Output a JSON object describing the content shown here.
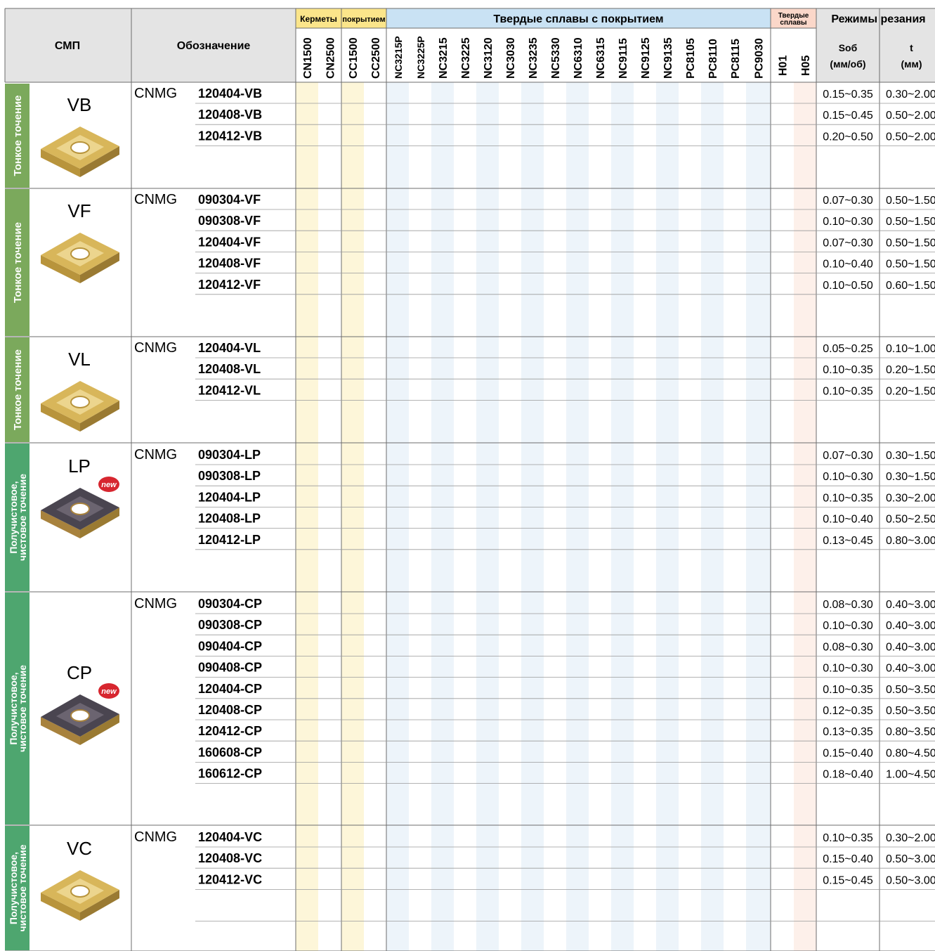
{
  "header": {
    "smp": "СМП",
    "designation": "Обозначение",
    "groups": {
      "cermets": "Керметы",
      "coated_cermets": "покрытием",
      "coated_carbides": "Твердые сплавы с покрытием",
      "carbides": "Твердые сплавы",
      "cutting": "Режимы резания"
    },
    "grades": [
      "CN1500",
      "CN2500",
      "CC1500",
      "CC2500",
      "NC3215P",
      "NC3225P",
      "NC3215",
      "NC3225",
      "NC3120",
      "NC3030",
      "NC3235",
      "NC5330",
      "NC6310",
      "NC6315",
      "NC9115",
      "NC9125",
      "NC9135",
      "PC8105",
      "PC8110",
      "PC8115",
      "PC9030",
      "H01",
      "H05"
    ],
    "feed": "Sоб",
    "feed_unit": "(мм/об)",
    "depth": "t",
    "depth_unit": "(мм)"
  },
  "new_badge": "new",
  "sections": [
    {
      "category": "Тонкое точение",
      "category_color": "#7ba95c",
      "code": "VB",
      "insert": "gold",
      "is_new": false,
      "rows": [
        {
          "prefix": "CNMG",
          "code": "120404-VB",
          "feed": "0.15~0.35",
          "depth": "0.30~2.00"
        },
        {
          "prefix": "",
          "code": "120408-VB",
          "feed": "0.15~0.45",
          "depth": "0.50~2.00"
        },
        {
          "prefix": "",
          "code": "120412-VB",
          "feed": "0.20~0.50",
          "depth": "0.50~2.00"
        }
      ]
    },
    {
      "category": "Тонкое точение",
      "category_color": "#7ba95c",
      "code": "VF",
      "insert": "gold-flat",
      "is_new": false,
      "rows": [
        {
          "prefix": "CNMG",
          "code": "090304-VF",
          "feed": "0.07~0.30",
          "depth": "0.50~1.50"
        },
        {
          "prefix": "",
          "code": "090308-VF",
          "feed": "0.10~0.30",
          "depth": "0.50~1.50"
        },
        {
          "prefix": "",
          "code": "120404-VF",
          "feed": "0.07~0.30",
          "depth": "0.50~1.50"
        },
        {
          "prefix": "",
          "code": "120408-VF",
          "feed": "0.10~0.40",
          "depth": "0.50~1.50"
        },
        {
          "prefix": "",
          "code": "120412-VF",
          "feed": "0.10~0.50",
          "depth": "0.60~1.50"
        }
      ]
    },
    {
      "category": "Тонкое точение",
      "category_color": "#7ba95c",
      "code": "VL",
      "insert": "gold",
      "is_new": false,
      "rows": [
        {
          "prefix": "CNMG",
          "code": "120404-VL",
          "feed": "0.05~0.25",
          "depth": "0.10~1.00"
        },
        {
          "prefix": "",
          "code": "120408-VL",
          "feed": "0.10~0.35",
          "depth": "0.20~1.50"
        },
        {
          "prefix": "",
          "code": "120412-VL",
          "feed": "0.10~0.35",
          "depth": "0.20~1.50"
        }
      ]
    },
    {
      "category": "Получистовое, чистовое точение",
      "category_color": "#4ea66f",
      "code": "LP",
      "insert": "dark",
      "is_new": true,
      "rows": [
        {
          "prefix": "CNMG",
          "code": "090304-LP",
          "feed": "0.07~0.30",
          "depth": "0.30~1.50"
        },
        {
          "prefix": "",
          "code": "090308-LP",
          "feed": "0.10~0.30",
          "depth": "0.30~1.50"
        },
        {
          "prefix": "",
          "code": "120404-LP",
          "feed": "0.10~0.35",
          "depth": "0.30~2.00"
        },
        {
          "prefix": "",
          "code": "120408-LP",
          "feed": "0.10~0.40",
          "depth": "0.50~2.50"
        },
        {
          "prefix": "",
          "code": "120412-LP",
          "feed": "0.13~0.45",
          "depth": "0.80~3.00"
        }
      ]
    },
    {
      "category": "Получистовое, чистовое точение",
      "category_color": "#4ea66f",
      "code": "CP",
      "insert": "dark",
      "is_new": true,
      "rows": [
        {
          "prefix": "CNMG",
          "code": "090304-CP",
          "feed": "0.08~0.30",
          "depth": "0.40~3.00"
        },
        {
          "prefix": "",
          "code": "090308-CP",
          "feed": "0.10~0.30",
          "depth": "0.40~3.00"
        },
        {
          "prefix": "",
          "code": "090404-CP",
          "feed": "0.08~0.30",
          "depth": "0.40~3.00"
        },
        {
          "prefix": "",
          "code": "090408-CP",
          "feed": "0.10~0.30",
          "depth": "0.40~3.00"
        },
        {
          "prefix": "",
          "code": "120404-CP",
          "feed": "0.10~0.35",
          "depth": "0.50~3.50"
        },
        {
          "prefix": "",
          "code": "120408-CP",
          "feed": "0.12~0.35",
          "depth": "0.50~3.50"
        },
        {
          "prefix": "",
          "code": "120412-CP",
          "feed": "0.13~0.35",
          "depth": "0.80~3.50"
        },
        {
          "prefix": "",
          "code": "160608-CP",
          "feed": "0.15~0.40",
          "depth": "0.80~4.50"
        },
        {
          "prefix": "",
          "code": "160612-CP",
          "feed": "0.18~0.40",
          "depth": "1.00~4.50"
        }
      ]
    },
    {
      "category": "Получистовое, чистовое точение",
      "category_color": "#4ea66f",
      "code": "VC",
      "insert": "gold",
      "is_new": false,
      "rows": [
        {
          "prefix": "CNMG",
          "code": "120404-VC",
          "feed": "0.10~0.35",
          "depth": "0.30~2.00"
        },
        {
          "prefix": "",
          "code": "120408-VC",
          "feed": "0.15~0.40",
          "depth": "0.50~3.00"
        },
        {
          "prefix": "",
          "code": "120412-VC",
          "feed": "0.15~0.45",
          "depth": "0.50~3.00"
        }
      ]
    }
  ],
  "colors": {
    "header_bg": "#e4e4e4",
    "cermet_hdr": "#fbe58a",
    "cermet_tint": "#fdf6d9",
    "coated_hdr": "#c9e2f4",
    "coated_tint": "#edf4fa",
    "carbide_hdr": "#fbd7c9",
    "carbide_tint": "#fdf0ea",
    "grid": "#6d6d6d",
    "new_badge": "#d7262f"
  }
}
